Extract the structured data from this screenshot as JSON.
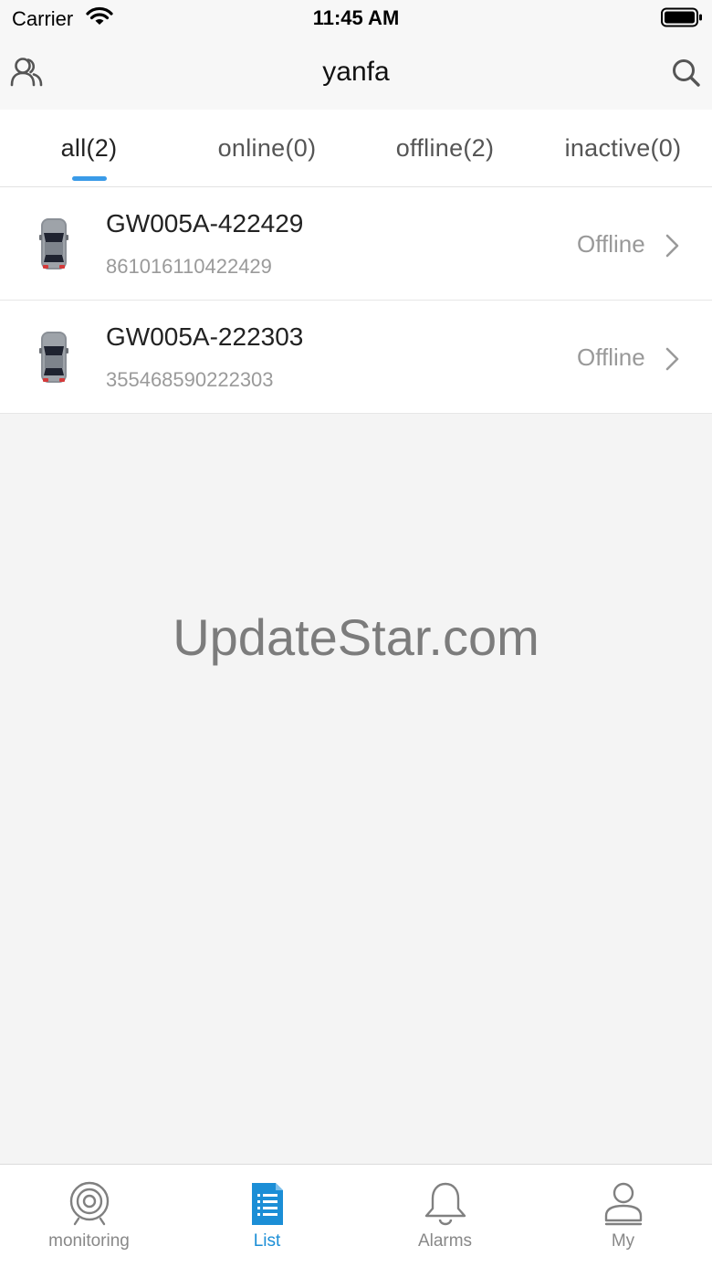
{
  "status_bar": {
    "carrier": "Carrier",
    "time": "11:45 AM"
  },
  "nav": {
    "title": "yanfa",
    "left_icon": "users-icon",
    "right_icon": "search-icon"
  },
  "tabs": [
    {
      "label": "all(2)",
      "active": true
    },
    {
      "label": "online(0)",
      "active": false
    },
    {
      "label": "offline(2)",
      "active": false
    },
    {
      "label": "inactive(0)",
      "active": false
    }
  ],
  "devices": [
    {
      "name": "GW005A-422429",
      "imei": "861016110422429",
      "status": "Offline"
    },
    {
      "name": "GW005A-222303",
      "imei": "355468590222303",
      "status": "Offline"
    }
  ],
  "watermark": "UpdateStar.com",
  "bottom_tabs": [
    {
      "label": "monitoring",
      "icon": "target-icon",
      "active": false
    },
    {
      "label": "List",
      "icon": "list-icon",
      "active": true
    },
    {
      "label": "Alarms",
      "icon": "bell-icon",
      "active": false
    },
    {
      "label": "My",
      "icon": "person-icon",
      "active": false
    }
  ],
  "colors": {
    "accent": "#1b8ed6",
    "tab_underline": "#3a9be8",
    "background": "#f4f4f4"
  }
}
